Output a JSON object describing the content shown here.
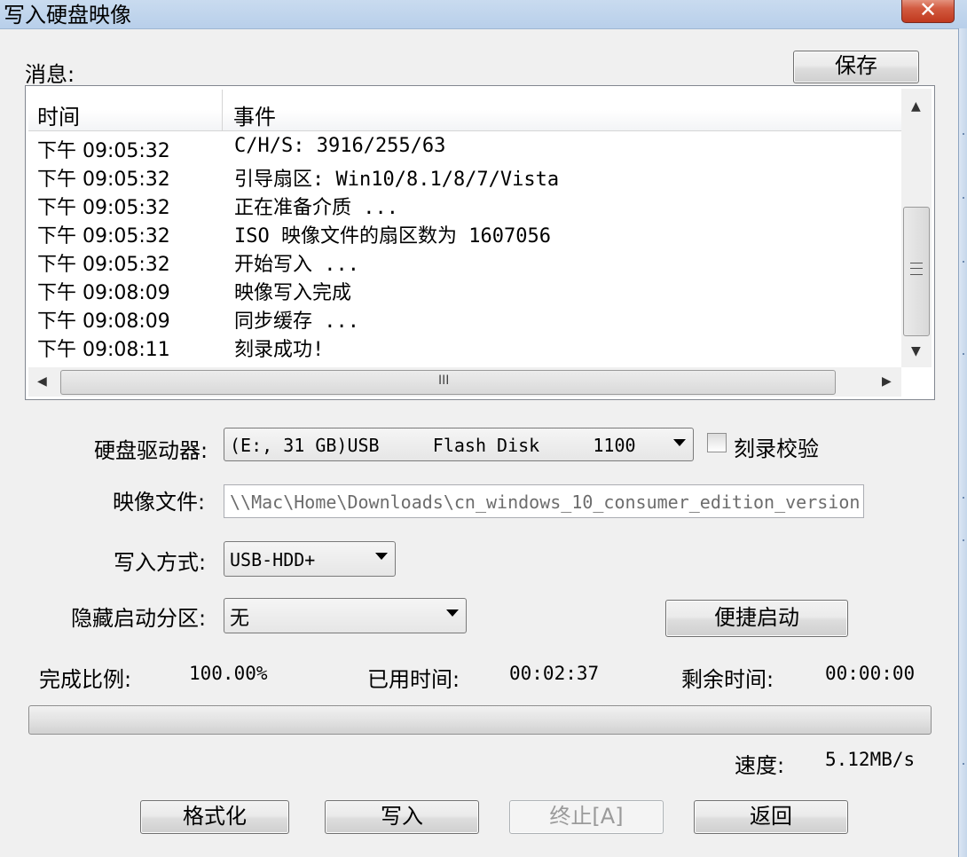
{
  "window": {
    "title": "写入硬盘映像",
    "close_label": "✕"
  },
  "messages": {
    "label": "消息:",
    "save_button": "保存",
    "columns": [
      "时间",
      "事件"
    ],
    "rows": [
      {
        "time": "下午 09:05:32",
        "event": "C/H/S: 3916/255/63"
      },
      {
        "time": "下午 09:05:32",
        "event": "引导扇区: Win10/8.1/8/7/Vista"
      },
      {
        "time": "下午 09:05:32",
        "event": "正在准备介质 ..."
      },
      {
        "time": "下午 09:05:32",
        "event": "ISO 映像文件的扇区数为 1607056"
      },
      {
        "time": "下午 09:05:32",
        "event": "开始写入 ..."
      },
      {
        "time": "下午 09:08:09",
        "event": "映像写入完成"
      },
      {
        "time": "下午 09:08:09",
        "event": "同步缓存 ..."
      },
      {
        "time": "下午 09:08:11",
        "event": "刻录成功!"
      }
    ],
    "hscroll_grip": "III"
  },
  "form": {
    "drive_label": "硬盘驱动器:",
    "drive_value": "(E:, 31 GB)USB     Flash Disk     1100",
    "verify_label": "刻录校验",
    "verify_checked": false,
    "image_label": "映像文件:",
    "image_value": "\\\\Mac\\Home\\Downloads\\cn_windows_10_consumer_edition_version",
    "write_mode_label": "写入方式:",
    "write_mode_value": "USB-HDD+",
    "hide_partition_label": "隐藏启动分区:",
    "hide_partition_value": "无",
    "quick_boot_button": "便捷启动"
  },
  "status": {
    "completion_label": "完成比例:",
    "completion_value": "100.00%",
    "completion_fraction": 1.0,
    "elapsed_label": "已用时间:",
    "elapsed_value": "00:02:37",
    "remaining_label": "剩余时间:",
    "remaining_value": "00:00:00",
    "speed_label": "速度:",
    "speed_value": "5.12MB/s"
  },
  "buttons": {
    "format": "格式化",
    "write": "写入",
    "stop": "终止[A]",
    "back": "返回"
  }
}
